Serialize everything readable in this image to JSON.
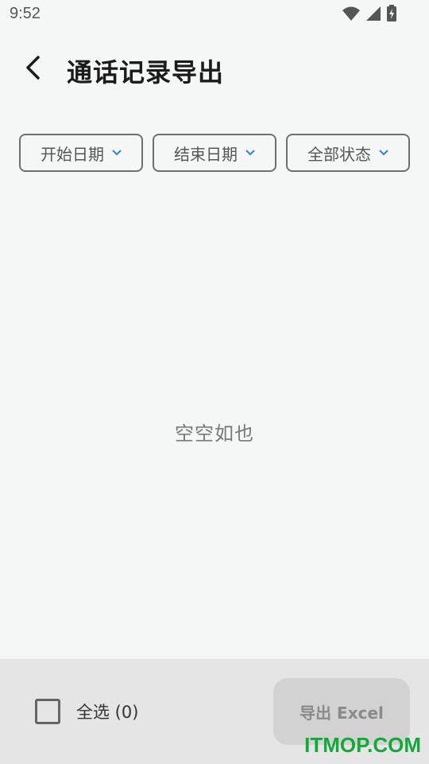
{
  "status_bar": {
    "time": "9:52",
    "icons": [
      "wifi-icon",
      "signal-icon",
      "battery-charging-icon"
    ]
  },
  "header": {
    "back_icon": "chevron-left-icon",
    "title": "通话记录导出"
  },
  "filters": [
    {
      "label": "开始日期",
      "icon": "chevron-down-icon"
    },
    {
      "label": "结束日期",
      "icon": "chevron-down-icon"
    },
    {
      "label": "全部状态",
      "icon": "chevron-down-icon"
    }
  ],
  "empty_state": {
    "text": "空空如也"
  },
  "footer": {
    "select_all_label": "全选 (0)",
    "select_all_checked": false,
    "export_label": "导出 Excel",
    "export_enabled": false
  },
  "watermark": "ITMOP.COM",
  "colors": {
    "background": "#f5f7f6",
    "bottom_bar": "#e5e5e5",
    "chevron_accent": "#2f80ed",
    "watermark": "#14a83b"
  }
}
